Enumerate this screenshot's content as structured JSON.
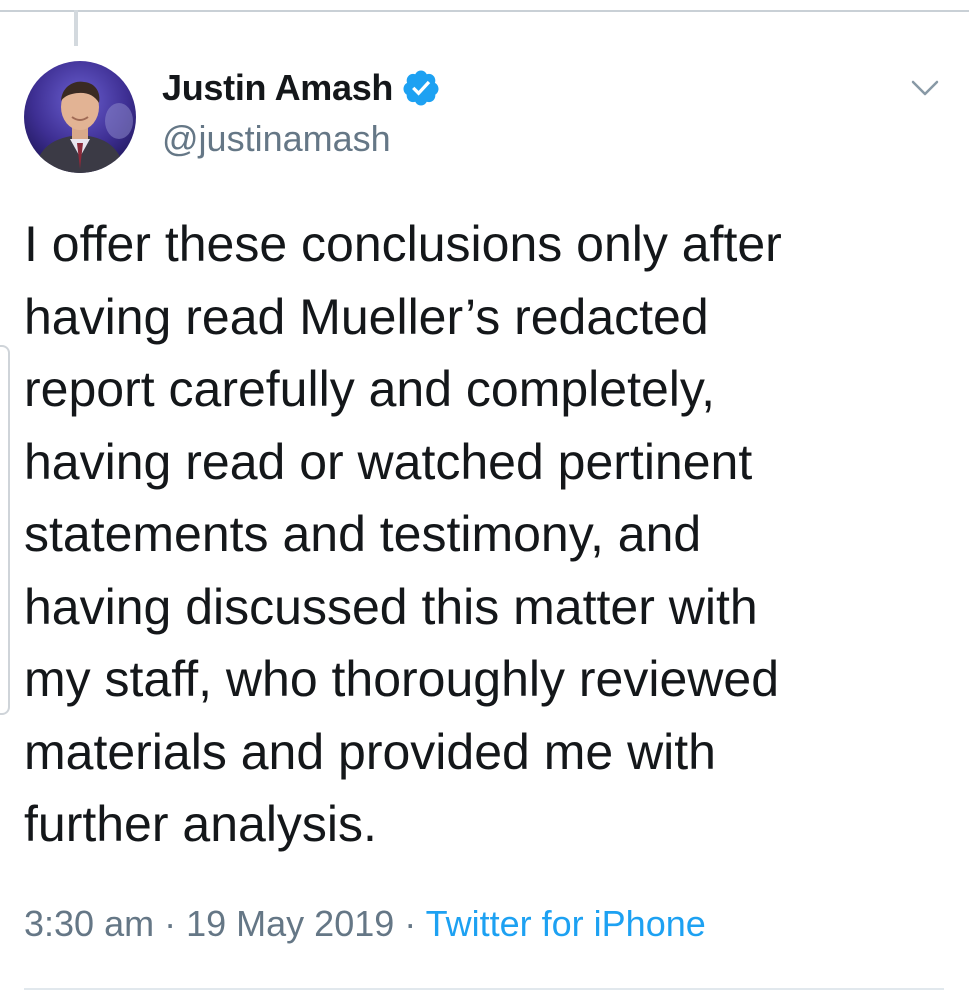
{
  "tweet": {
    "author": {
      "display_name": "Justin Amash",
      "handle": "@justinamash",
      "verified": true,
      "verified_icon": "verified-badge-icon",
      "avatar_icon": "profile-photo"
    },
    "menu_icon": "chevron-down-icon",
    "text_lines": [
      "I offer these conclusions only after",
      "having read Mueller’s redacted",
      "report carefully and completely,",
      "having read or watched pertinent",
      "statements and testimony, and",
      "having discussed this matter with",
      "my staff, who thoroughly reviewed",
      "materials and provided me with",
      "further analysis."
    ],
    "time": "3:30 am",
    "separator": "·",
    "date": "19 May 2019",
    "source": "Twitter for iPhone"
  },
  "colors": {
    "text": "#14171a",
    "secondary": "#657786",
    "accent": "#1da1f2",
    "divider": "#e1e8ed"
  }
}
